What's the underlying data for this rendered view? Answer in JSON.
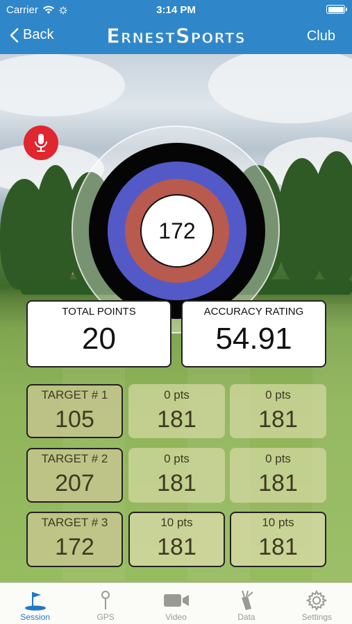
{
  "status_bar": {
    "carrier": "Carrier",
    "time": "3:14 PM"
  },
  "nav": {
    "back_label": "Back",
    "brand": "ErnestSports",
    "club_label": "Club"
  },
  "target": {
    "center_value": "172"
  },
  "summary": {
    "total_points": {
      "label": "TOTAL POINTS",
      "value": "20"
    },
    "accuracy_rating": {
      "label": "ACCURACY RATING",
      "value": "54.91"
    }
  },
  "targets": [
    {
      "label": "TARGET # 1",
      "value": "105",
      "shots": [
        {
          "pts": "0 pts",
          "value": "181"
        },
        {
          "pts": "0 pts",
          "value": "181"
        }
      ]
    },
    {
      "label": "TARGET # 2",
      "value": "207",
      "shots": [
        {
          "pts": "0 pts",
          "value": "181"
        },
        {
          "pts": "0 pts",
          "value": "181"
        }
      ]
    },
    {
      "label": "TARGET # 3",
      "value": "172",
      "shots": [
        {
          "pts": "10 pts",
          "value": "181"
        },
        {
          "pts": "10 pts",
          "value": "181"
        }
      ]
    }
  ],
  "tabs": [
    {
      "label": "Session",
      "icon": "golf-flag-icon",
      "active": true
    },
    {
      "label": "GPS",
      "icon": "tee-pin-icon",
      "active": false
    },
    {
      "label": "Video",
      "icon": "video-camera-icon",
      "active": false
    },
    {
      "label": "Data",
      "icon": "golf-bag-icon",
      "active": false
    },
    {
      "label": "Settings",
      "icon": "gear-icon",
      "active": false
    }
  ],
  "colors": {
    "nav": "#2f86c8",
    "active_tab": "#1f78c8",
    "mic": "#e0262f"
  }
}
